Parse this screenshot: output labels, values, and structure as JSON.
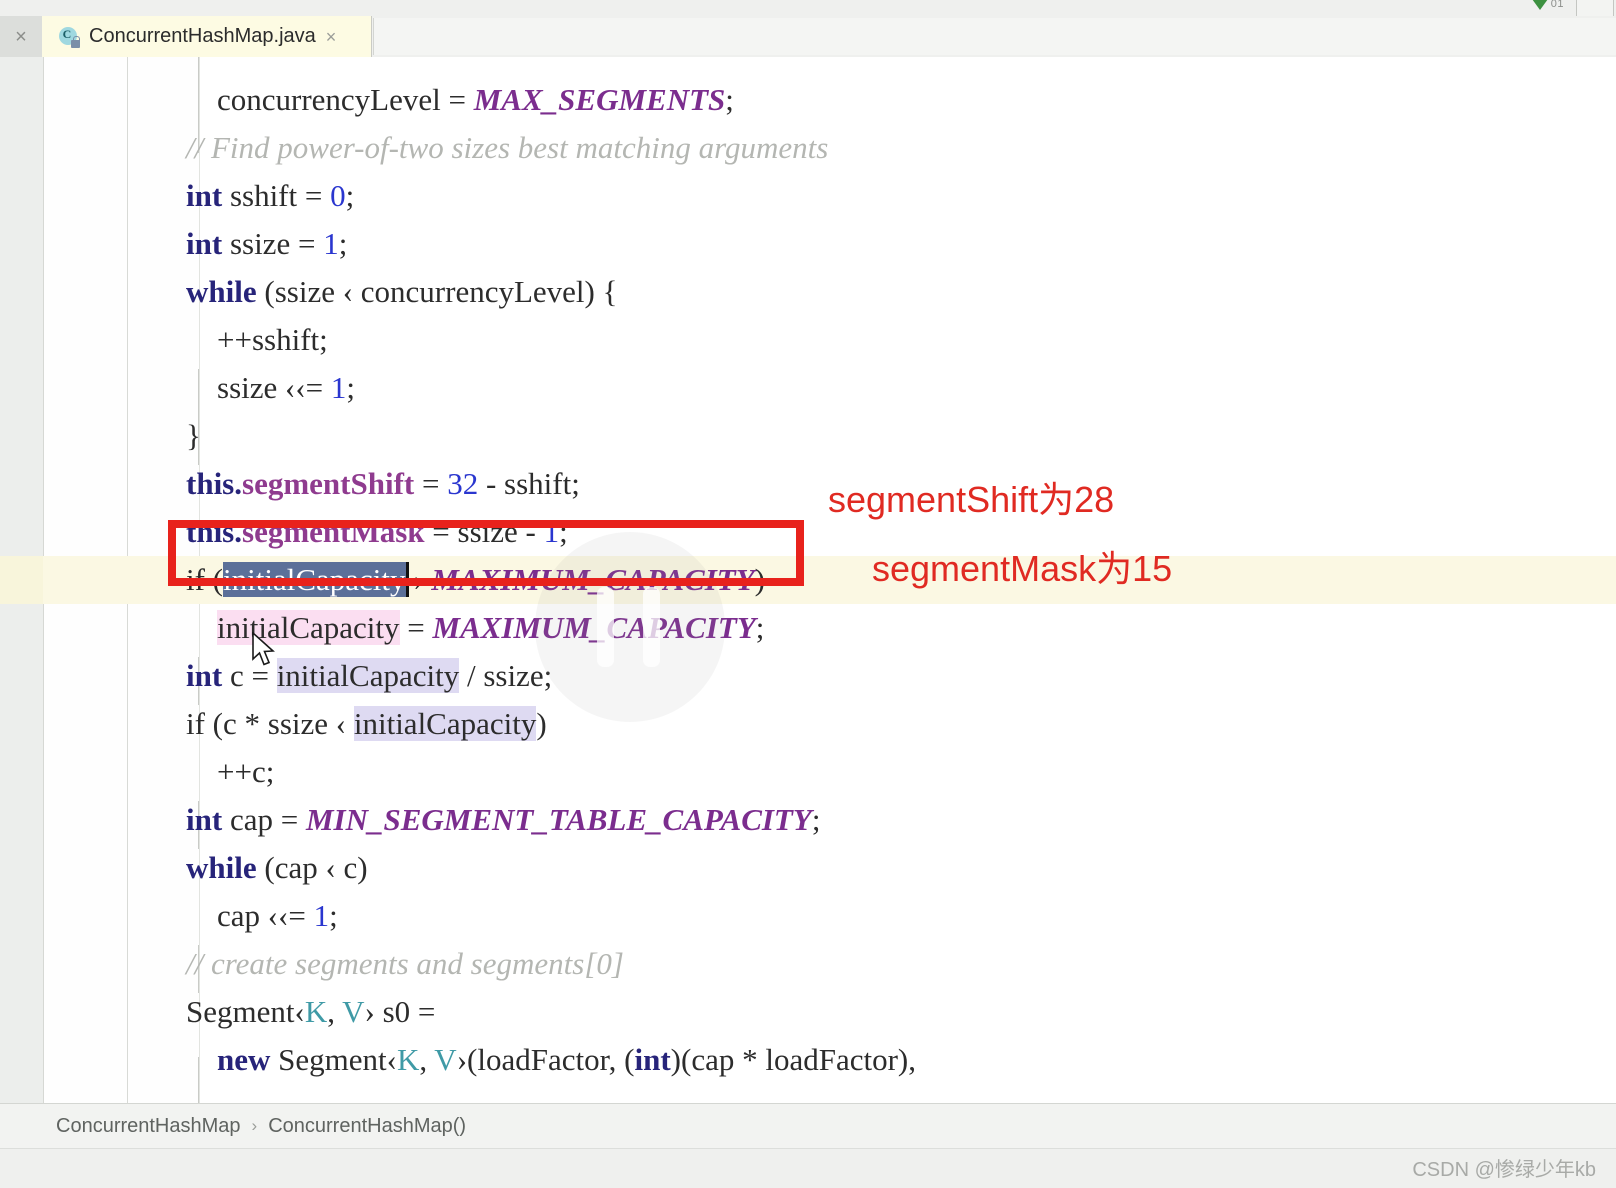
{
  "window": {
    "top_indicator_count": "01"
  },
  "tabbar": {
    "close_all_glyph": "×",
    "tab": {
      "icon_letter": "C",
      "title": "ConcurrentHashMap.java",
      "close_glyph": "×"
    }
  },
  "editor": {
    "language": "java",
    "lines": [
      {
        "indent": 0,
        "segments": [
          {
            "t": "",
            "c": "plain"
          }
        ]
      },
      {
        "indent": 0,
        "segments": [
          {
            "t": "    concurrencyLevel = ",
            "c": "plain"
          },
          {
            "t": "MAX_SEGMENTS",
            "c": "cst"
          },
          {
            "t": ";",
            "c": "plain"
          }
        ]
      },
      {
        "indent": 0,
        "segments": [
          {
            "t": "// Find power-of-two sizes best matching arguments",
            "c": "cmt"
          }
        ]
      },
      {
        "indent": 0,
        "segments": [
          {
            "t": "int",
            "c": "kw"
          },
          {
            "t": " sshift = ",
            "c": "plain"
          },
          {
            "t": "0",
            "c": "num"
          },
          {
            "t": ";",
            "c": "plain"
          }
        ]
      },
      {
        "indent": 0,
        "segments": [
          {
            "t": "int",
            "c": "kw"
          },
          {
            "t": " ssize = ",
            "c": "plain"
          },
          {
            "t": "1",
            "c": "num"
          },
          {
            "t": ";",
            "c": "plain"
          }
        ]
      },
      {
        "indent": 0,
        "segments": [
          {
            "t": "while",
            "c": "kw"
          },
          {
            "t": " (ssize ‹ concurrencyLevel) {",
            "c": "plain"
          }
        ]
      },
      {
        "indent": 0,
        "segments": [
          {
            "t": "    ++sshift;",
            "c": "plain"
          }
        ]
      },
      {
        "indent": 0,
        "segments": [
          {
            "t": "    ssize ‹‹= ",
            "c": "plain"
          },
          {
            "t": "1",
            "c": "num"
          },
          {
            "t": ";",
            "c": "plain"
          }
        ]
      },
      {
        "indent": 0,
        "segments": [
          {
            "t": "}",
            "c": "plain"
          }
        ]
      },
      {
        "indent": 0,
        "segments": [
          {
            "t": "this.",
            "c": "kwt"
          },
          {
            "t": "segmentShift",
            "c": "fld"
          },
          {
            "t": " = ",
            "c": "plain"
          },
          {
            "t": "32",
            "c": "num"
          },
          {
            "t": " - sshift;",
            "c": "plain"
          }
        ]
      },
      {
        "indent": 0,
        "segments": [
          {
            "t": "this.",
            "c": "kwt"
          },
          {
            "t": "segmentMask",
            "c": "fld"
          },
          {
            "t": " = ssize - ",
            "c": "plain"
          },
          {
            "t": "1",
            "c": "num"
          },
          {
            "t": ";",
            "c": "plain"
          }
        ]
      },
      {
        "indent": 0,
        "segments": [
          {
            "t": "if (",
            "c": "plain"
          },
          {
            "t": "initialCapacity",
            "c": "sel"
          },
          {
            "t": " › ",
            "c": "plain"
          },
          {
            "t": "MAXIMUM_CAPACITY",
            "c": "cst"
          },
          {
            "t": ")",
            "c": "plain"
          }
        ]
      },
      {
        "indent": 0,
        "segments": [
          {
            "t": "    ",
            "c": "plain"
          },
          {
            "t": "initialCapacity",
            "c": "occw"
          },
          {
            "t": " = ",
            "c": "plain"
          },
          {
            "t": "MAXIMUM_CAPACITY",
            "c": "cst"
          },
          {
            "t": ";",
            "c": "plain"
          }
        ]
      },
      {
        "indent": 0,
        "segments": [
          {
            "t": "int",
            "c": "kw"
          },
          {
            "t": " c = ",
            "c": "plain"
          },
          {
            "t": "initialCapacity",
            "c": "occ"
          },
          {
            "t": " / ssize;",
            "c": "plain"
          }
        ]
      },
      {
        "indent": 0,
        "segments": [
          {
            "t": "if (c * ssize ‹ ",
            "c": "plain"
          },
          {
            "t": "initialCapacity",
            "c": "occ"
          },
          {
            "t": ")",
            "c": "plain"
          }
        ]
      },
      {
        "indent": 0,
        "segments": [
          {
            "t": "    ++c;",
            "c": "plain"
          }
        ]
      },
      {
        "indent": 0,
        "segments": [
          {
            "t": "int",
            "c": "kw"
          },
          {
            "t": " cap = ",
            "c": "plain"
          },
          {
            "t": "MIN_SEGMENT_TABLE_CAPACITY",
            "c": "cst"
          },
          {
            "t": ";",
            "c": "plain"
          }
        ]
      },
      {
        "indent": 0,
        "segments": [
          {
            "t": "while",
            "c": "kw"
          },
          {
            "t": " (cap ‹ c)",
            "c": "plain"
          }
        ]
      },
      {
        "indent": 0,
        "segments": [
          {
            "t": "    cap ‹‹= ",
            "c": "plain"
          },
          {
            "t": "1",
            "c": "num"
          },
          {
            "t": ";",
            "c": "plain"
          }
        ]
      },
      {
        "indent": 0,
        "segments": [
          {
            "t": "// create segments and segments[0]",
            "c": "cmt"
          }
        ]
      },
      {
        "indent": 0,
        "segments": [
          {
            "t": "Segment‹",
            "c": "plain"
          },
          {
            "t": "K",
            "c": "gen"
          },
          {
            "t": ", ",
            "c": "plain"
          },
          {
            "t": "V",
            "c": "gen"
          },
          {
            "t": "› s0 =",
            "c": "plain"
          }
        ]
      },
      {
        "indent": 0,
        "segments": [
          {
            "t": "    ",
            "c": "plain"
          },
          {
            "t": "new",
            "c": "kw"
          },
          {
            "t": " Segment‹",
            "c": "plain"
          },
          {
            "t": "K",
            "c": "gen"
          },
          {
            "t": ", ",
            "c": "plain"
          },
          {
            "t": "V",
            "c": "gen"
          },
          {
            "t": "›(loadFactor, (",
            "c": "plain"
          },
          {
            "t": "int",
            "c": "kw"
          },
          {
            "t": ")(cap * loadFactor),",
            "c": "plain"
          }
        ]
      }
    ],
    "selection": {
      "text": "initialCapacity",
      "caret_visible": true
    }
  },
  "annotations": {
    "color": "#e02a22",
    "box_color": "#e8221c",
    "items": [
      {
        "text": "segmentShift为28"
      },
      {
        "text": "segmentMask为15"
      }
    ]
  },
  "breadcrumb": {
    "separator": "›",
    "items": [
      "ConcurrentHashMap",
      "ConcurrentHashMap()"
    ]
  },
  "footer": {
    "watermark": "CSDN @惨绿少年kb"
  }
}
